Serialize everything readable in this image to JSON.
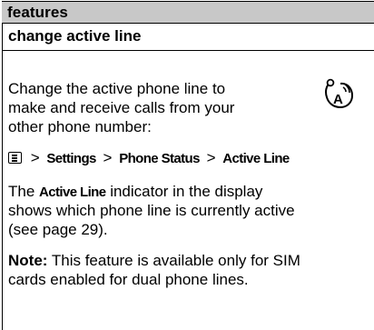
{
  "header": {
    "section_label": "features"
  },
  "feature": {
    "title": "change active line",
    "intro_lines": [
      "Change the active phone line to",
      "make and receive calls from your",
      "other phone number:"
    ],
    "icon_badge": "A",
    "path": {
      "sep": ">",
      "items": [
        "Settings",
        "Phone Status",
        "Active Line"
      ]
    },
    "indicator": {
      "prefix": "The",
      "term": "Active Line",
      "suffix": "indicator in the display",
      "line2": "shows which phone line is currently active",
      "line3": "(see page 29)."
    },
    "note": {
      "label": "Note:",
      "line1_rest": " This feature is available only for SIM",
      "line2": "cards enabled for dual phone lines."
    }
  }
}
